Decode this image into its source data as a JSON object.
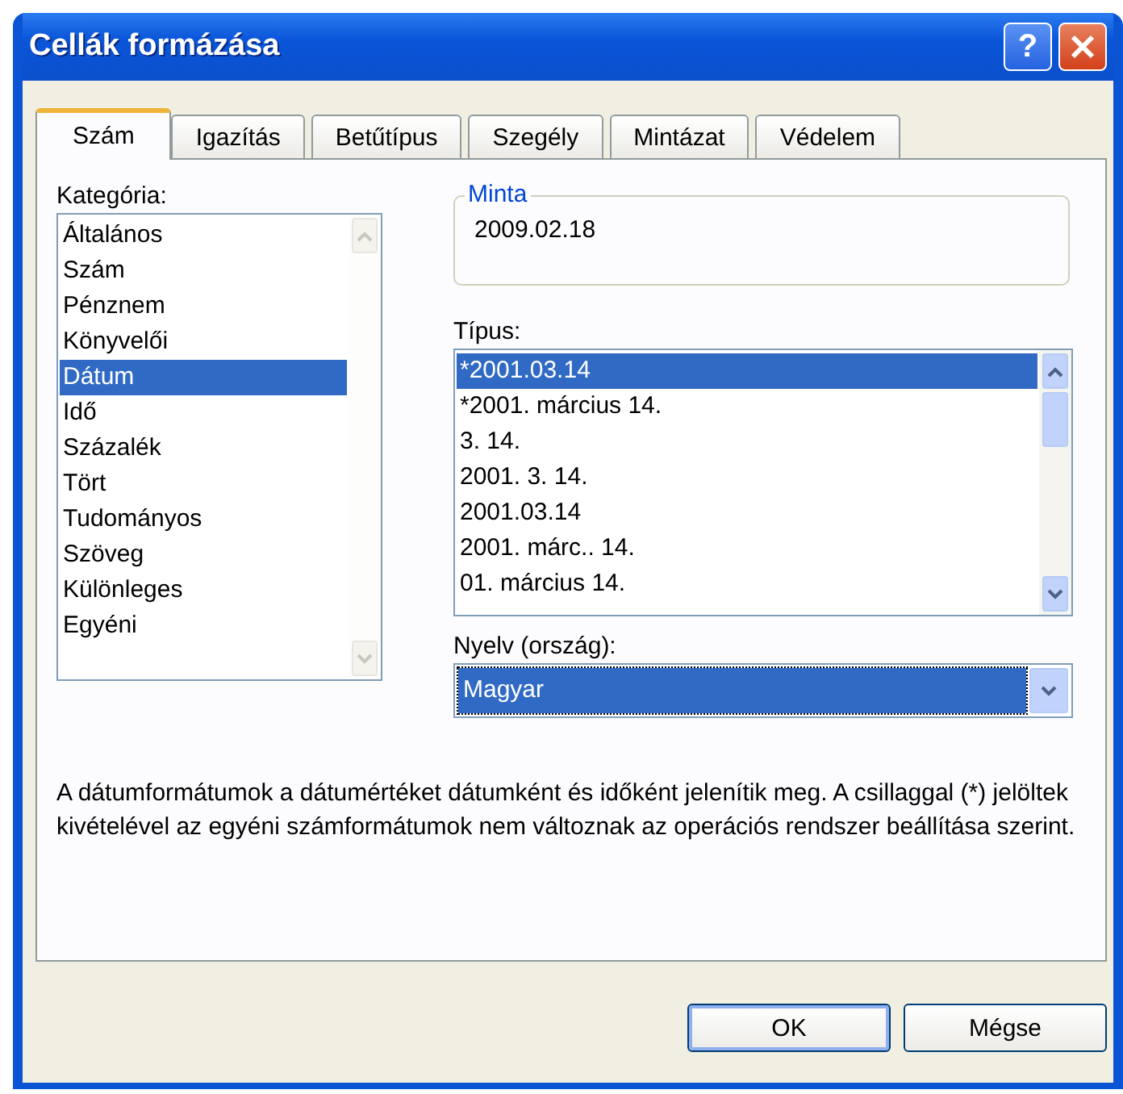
{
  "window": {
    "title": "Cellák formázása",
    "help": "?"
  },
  "tabs": [
    {
      "label": "Szám",
      "selected": true
    },
    {
      "label": "Igazítás",
      "selected": false
    },
    {
      "label": "Betűtípus",
      "selected": false
    },
    {
      "label": "Szegély",
      "selected": false
    },
    {
      "label": "Mintázat",
      "selected": false
    },
    {
      "label": "Védelem",
      "selected": false
    }
  ],
  "category": {
    "label": "Kategória:",
    "items": [
      {
        "label": "Általános",
        "selected": false
      },
      {
        "label": "Szám",
        "selected": false
      },
      {
        "label": "Pénznem",
        "selected": false
      },
      {
        "label": "Könyvelői",
        "selected": false
      },
      {
        "label": "Dátum",
        "selected": true
      },
      {
        "label": "Idő",
        "selected": false
      },
      {
        "label": "Százalék",
        "selected": false
      },
      {
        "label": "Tört",
        "selected": false
      },
      {
        "label": "Tudományos",
        "selected": false
      },
      {
        "label": "Szöveg",
        "selected": false
      },
      {
        "label": "Különleges",
        "selected": false
      },
      {
        "label": "Egyéni",
        "selected": false
      }
    ]
  },
  "sample": {
    "label": "Minta",
    "value": "2009.02.18"
  },
  "type": {
    "label": "Típus:",
    "items": [
      {
        "label": "*2001.03.14",
        "selected": true
      },
      {
        "label": "*2001. március 14.",
        "selected": false
      },
      {
        "label": "3. 14.",
        "selected": false
      },
      {
        "label": "2001. 3. 14.",
        "selected": false
      },
      {
        "label": "2001.03.14",
        "selected": false
      },
      {
        "label": "2001. márc.. 14.",
        "selected": false
      },
      {
        "label": "01. március 14.",
        "selected": false
      }
    ]
  },
  "language": {
    "label": "Nyelv (ország):",
    "value": "Magyar"
  },
  "description": "A dátumformátumok a dátumértéket dátumként és időként jelenítik meg. A csillaggal (*) jelöltek kivételével az egyéni számformátumok nem változnak az operációs rendszer beállítása szerint.",
  "buttons": [
    {
      "label": "OK",
      "default": true
    },
    {
      "label": "Mégse",
      "default": false
    }
  ]
}
